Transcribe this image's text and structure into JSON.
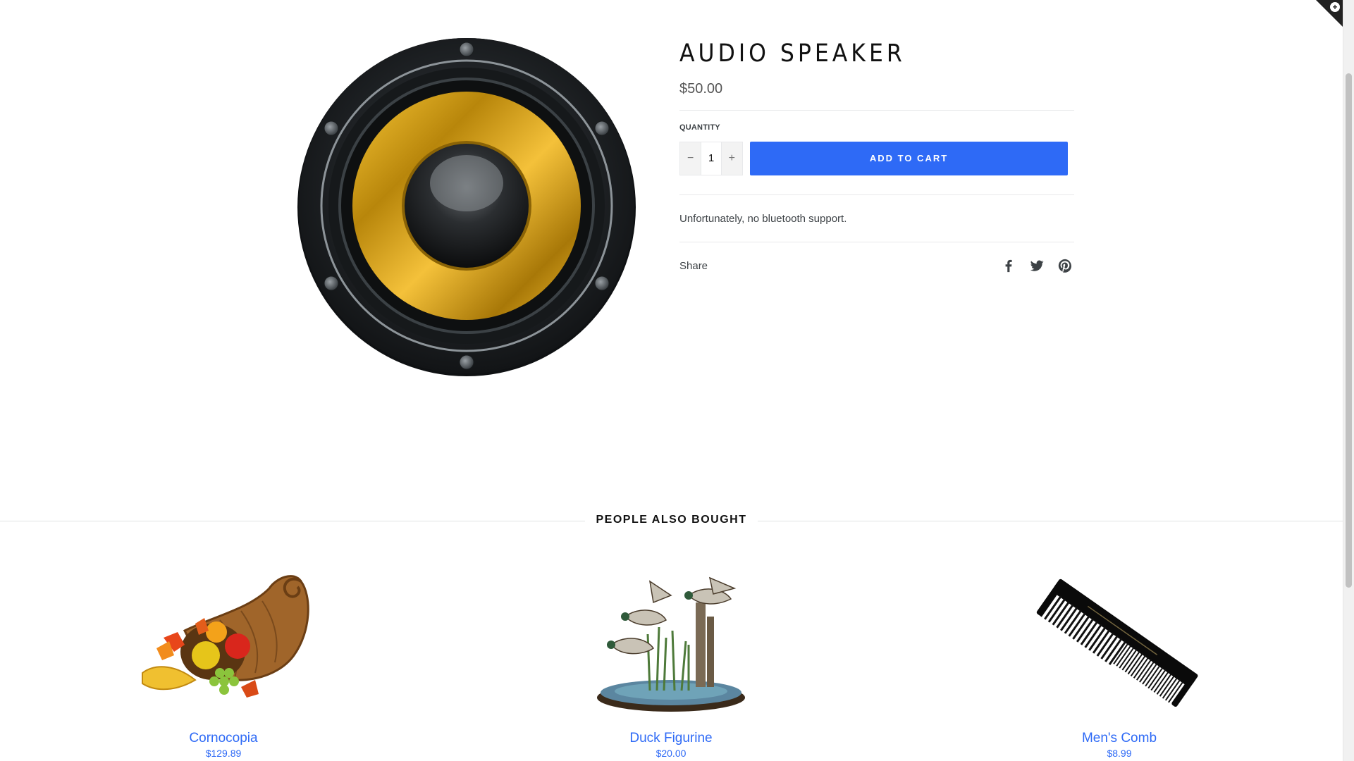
{
  "product": {
    "title": "AUDIO SPEAKER",
    "price": "$50.00",
    "quantity_label": "QUANTITY",
    "quantity_value": "1",
    "minus_label": "−",
    "plus_label": "+",
    "add_to_cart_label": "ADD TO CART",
    "description": "Unfortunately, no bluetooth support.",
    "share_label": "Share",
    "share_icons": [
      "facebook-icon",
      "twitter-icon",
      "pinterest-icon"
    ]
  },
  "related": {
    "heading": "PEOPLE ALSO BOUGHT",
    "items": [
      {
        "name": "Cornocopia",
        "price": "$129.89"
      },
      {
        "name": "Duck Figurine",
        "price": "$20.00"
      },
      {
        "name": "Men's Comb",
        "price": "$8.99"
      }
    ]
  },
  "colors": {
    "accent": "#2e6af6",
    "speaker_gold": "#d9a51f",
    "speaker_frame": "#1f2326"
  }
}
